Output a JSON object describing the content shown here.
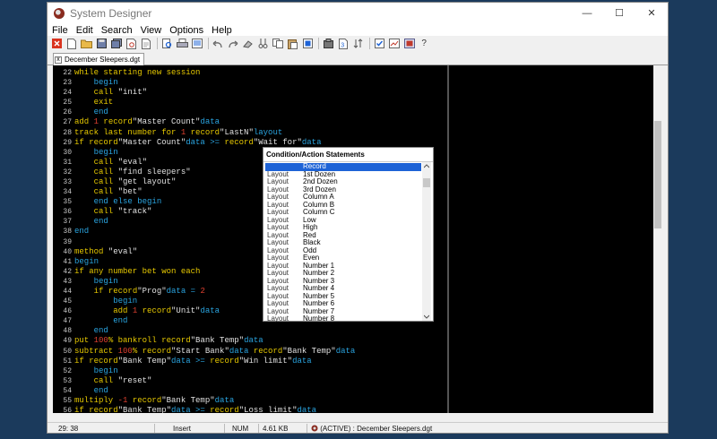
{
  "window": {
    "title": "System Designer",
    "controls": [
      "—",
      "☐",
      "✕"
    ]
  },
  "menu": [
    "File",
    "Edit",
    "Search",
    "View",
    "Options",
    "Help"
  ],
  "tab": {
    "label": "December Sleepers.dgt",
    "close": "x"
  },
  "code": [
    {
      "n": "22",
      "segs": [
        [
          "while starting new session",
          "#e6c800"
        ]
      ]
    },
    {
      "n": "23",
      "segs": [
        [
          "    begin",
          "#2aa4e0"
        ]
      ]
    },
    {
      "n": "24",
      "segs": [
        [
          "    call ",
          "#e6c800"
        ],
        [
          "\"init\"",
          "#e0e0e0"
        ]
      ]
    },
    {
      "n": "25",
      "segs": [
        [
          "    exit",
          "#e6c800"
        ]
      ]
    },
    {
      "n": "26",
      "segs": [
        [
          "    end",
          "#2aa4e0"
        ]
      ]
    },
    {
      "n": "27",
      "segs": [
        [
          "add ",
          "#e6c800"
        ],
        [
          "1 ",
          "#e04030"
        ],
        [
          "record",
          "#e6c800"
        ],
        [
          "\"Master Count\"",
          "#e0e0e0"
        ],
        [
          "data",
          "#2aa4e0"
        ]
      ]
    },
    {
      "n": "28",
      "segs": [
        [
          "track last number for ",
          "#e6c800"
        ],
        [
          "1 ",
          "#e04030"
        ],
        [
          "record",
          "#e6c800"
        ],
        [
          "\"LastN\"",
          "#e0e0e0"
        ],
        [
          "layout",
          "#2aa4e0"
        ]
      ]
    },
    {
      "n": "29",
      "segs": [
        [
          "if ",
          "#e6c800"
        ],
        [
          "record",
          "#e6c800"
        ],
        [
          "\"Master Count\"",
          "#e0e0e0"
        ],
        [
          "data >= ",
          "#2aa4e0"
        ],
        [
          "record",
          "#e6c800"
        ],
        [
          "\"Wait for\"",
          "#e0e0e0"
        ],
        [
          "data",
          "#2aa4e0"
        ]
      ]
    },
    {
      "n": "30",
      "segs": [
        [
          "    begin",
          "#2aa4e0"
        ]
      ]
    },
    {
      "n": "31",
      "segs": [
        [
          "    call ",
          "#e6c800"
        ],
        [
          "\"eval\"",
          "#e0e0e0"
        ]
      ]
    },
    {
      "n": "32",
      "segs": [
        [
          "    call ",
          "#e6c800"
        ],
        [
          "\"find sleepers\"",
          "#e0e0e0"
        ]
      ]
    },
    {
      "n": "33",
      "segs": [
        [
          "    call ",
          "#e6c800"
        ],
        [
          "\"get layout\"",
          "#e0e0e0"
        ]
      ]
    },
    {
      "n": "34",
      "segs": [
        [
          "    call ",
          "#e6c800"
        ],
        [
          "\"bet\"",
          "#e0e0e0"
        ]
      ]
    },
    {
      "n": "35",
      "segs": [
        [
          "    end else begin",
          "#2aa4e0"
        ]
      ]
    },
    {
      "n": "36",
      "segs": [
        [
          "    call ",
          "#e6c800"
        ],
        [
          "\"track\"",
          "#e0e0e0"
        ]
      ]
    },
    {
      "n": "37",
      "segs": [
        [
          "    end",
          "#2aa4e0"
        ]
      ]
    },
    {
      "n": "38",
      "segs": [
        [
          "end",
          "#2aa4e0"
        ]
      ]
    },
    {
      "n": "39",
      "segs": []
    },
    {
      "n": "40",
      "segs": [
        [
          "method ",
          "#e6c800"
        ],
        [
          "\"eval\"",
          "#e0e0e0"
        ]
      ]
    },
    {
      "n": "41",
      "segs": [
        [
          "begin",
          "#2aa4e0"
        ]
      ]
    },
    {
      "n": "42",
      "segs": [
        [
          "if any number bet won each",
          "#e6c800"
        ]
      ]
    },
    {
      "n": "43",
      "segs": [
        [
          "    begin",
          "#2aa4e0"
        ]
      ]
    },
    {
      "n": "44",
      "segs": [
        [
          "    if ",
          "#e6c800"
        ],
        [
          "record",
          "#e6c800"
        ],
        [
          "\"Prog\"",
          "#e0e0e0"
        ],
        [
          "data = ",
          "#2aa4e0"
        ],
        [
          "2",
          "#e04030"
        ]
      ]
    },
    {
      "n": "45",
      "segs": [
        [
          "        begin",
          "#2aa4e0"
        ]
      ]
    },
    {
      "n": "46",
      "segs": [
        [
          "        add ",
          "#e6c800"
        ],
        [
          "1 ",
          "#e04030"
        ],
        [
          "record",
          "#e6c800"
        ],
        [
          "\"Unit\"",
          "#e0e0e0"
        ],
        [
          "data",
          "#2aa4e0"
        ]
      ]
    },
    {
      "n": "47",
      "segs": [
        [
          "        end",
          "#2aa4e0"
        ]
      ]
    },
    {
      "n": "48",
      "segs": [
        [
          "    end",
          "#2aa4e0"
        ]
      ]
    },
    {
      "n": "49",
      "segs": [
        [
          "put ",
          "#e6c800"
        ],
        [
          "100",
          "#e04030"
        ],
        [
          "% bankroll ",
          "#e6c800"
        ],
        [
          "record",
          "#e6c800"
        ],
        [
          "\"Bank Temp\"",
          "#e0e0e0"
        ],
        [
          "data",
          "#2aa4e0"
        ]
      ]
    },
    {
      "n": "50",
      "segs": [
        [
          "subtract ",
          "#e6c800"
        ],
        [
          "100",
          "#e04030"
        ],
        [
          "% ",
          "#e6c800"
        ],
        [
          "record",
          "#e6c800"
        ],
        [
          "\"Start Bank\"",
          "#e0e0e0"
        ],
        [
          "data ",
          "#2aa4e0"
        ],
        [
          "record",
          "#e6c800"
        ],
        [
          "\"Bank Temp\"",
          "#e0e0e0"
        ],
        [
          "data",
          "#2aa4e0"
        ]
      ]
    },
    {
      "n": "51",
      "segs": [
        [
          "if ",
          "#e6c800"
        ],
        [
          "record",
          "#e6c800"
        ],
        [
          "\"Bank Temp\"",
          "#e0e0e0"
        ],
        [
          "data >= ",
          "#2aa4e0"
        ],
        [
          "record",
          "#e6c800"
        ],
        [
          "\"Win limit\"",
          "#e0e0e0"
        ],
        [
          "data",
          "#2aa4e0"
        ]
      ]
    },
    {
      "n": "52",
      "segs": [
        [
          "    begin",
          "#2aa4e0"
        ]
      ]
    },
    {
      "n": "53",
      "segs": [
        [
          "    call ",
          "#e6c800"
        ],
        [
          "\"reset\"",
          "#e0e0e0"
        ]
      ]
    },
    {
      "n": "54",
      "segs": [
        [
          "    end",
          "#2aa4e0"
        ]
      ]
    },
    {
      "n": "55",
      "segs": [
        [
          "multiply ",
          "#e6c800"
        ],
        [
          "-1 ",
          "#e04030"
        ],
        [
          "record",
          "#e6c800"
        ],
        [
          "\"Bank Temp\"",
          "#e0e0e0"
        ],
        [
          "data",
          "#2aa4e0"
        ]
      ]
    },
    {
      "n": "56",
      "segs": [
        [
          "if ",
          "#e6c800"
        ],
        [
          "record",
          "#e6c800"
        ],
        [
          "\"Bank Temp\"",
          "#e0e0e0"
        ],
        [
          "data >= ",
          "#2aa4e0"
        ],
        [
          "record",
          "#e6c800"
        ],
        [
          "\"Loss limit\"",
          "#e0e0e0"
        ],
        [
          "data",
          "#2aa4e0"
        ]
      ]
    }
  ],
  "popup": {
    "title": "Condition/Action Statements",
    "rows": [
      {
        "k": "",
        "v": "Record",
        "selected": true
      },
      {
        "k": "Layout",
        "v": "1st Dozen"
      },
      {
        "k": "Layout",
        "v": "2nd Dozen"
      },
      {
        "k": "Layout",
        "v": "3rd Dozen"
      },
      {
        "k": "Layout",
        "v": "Column A"
      },
      {
        "k": "Layout",
        "v": "Column B"
      },
      {
        "k": "Layout",
        "v": "Column C"
      },
      {
        "k": "Layout",
        "v": "Low"
      },
      {
        "k": "Layout",
        "v": "High"
      },
      {
        "k": "Layout",
        "v": "Red"
      },
      {
        "k": "Layout",
        "v": "Black"
      },
      {
        "k": "Layout",
        "v": "Odd"
      },
      {
        "k": "Layout",
        "v": "Even"
      },
      {
        "k": "Layout",
        "v": "Number 1"
      },
      {
        "k": "Layout",
        "v": "Number 2"
      },
      {
        "k": "Layout",
        "v": "Number 3"
      },
      {
        "k": "Layout",
        "v": "Number 4"
      },
      {
        "k": "Layout",
        "v": "Number 5"
      },
      {
        "k": "Layout",
        "v": "Number 6"
      },
      {
        "k": "Layout",
        "v": "Number 7"
      },
      {
        "k": "Layout",
        "v": "Number 8"
      }
    ]
  },
  "status": {
    "position": "29: 38",
    "mode": "Insert",
    "num": "NUM",
    "size": "4.61 KB",
    "file": "(ACTIVE) : December Sleepers.dgt"
  }
}
